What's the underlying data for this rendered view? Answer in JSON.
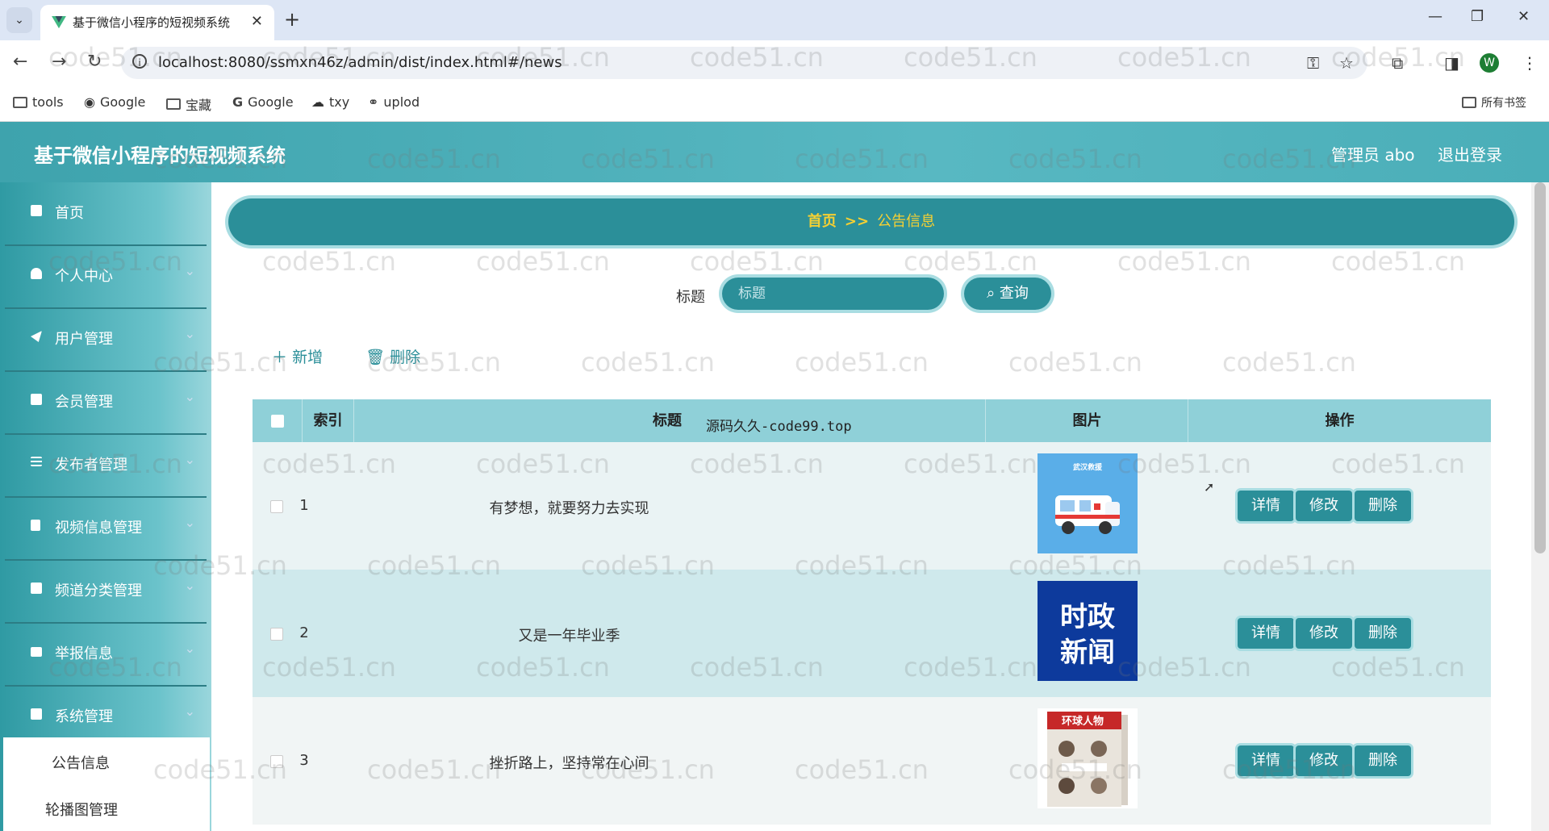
{
  "browser": {
    "tab_title": "基于微信小程序的短视频系统",
    "url": "localhost:8080/ssmxn46z/admin/dist/index.html#/news",
    "bookmarks": [
      "tools",
      "Google",
      "宝藏",
      "Google",
      "txy",
      "uplod"
    ],
    "all_bookmarks": "所有书签",
    "profile_initial": "W"
  },
  "header": {
    "brand": "基于微信小程序的短视频系统",
    "user": "管理员 abo",
    "logout": "退出登录"
  },
  "sidebar": {
    "items": [
      {
        "label": "首页",
        "icon": "home-icon"
      },
      {
        "label": "个人中心",
        "icon": "user-icon"
      },
      {
        "label": "用户管理",
        "icon": "send-icon"
      },
      {
        "label": "会员管理",
        "icon": "grid-icon"
      },
      {
        "label": "发布者管理",
        "icon": "list-icon"
      },
      {
        "label": "视频信息管理",
        "icon": "flag-icon"
      },
      {
        "label": "频道分类管理",
        "icon": "grid-icon"
      },
      {
        "label": "举报信息",
        "icon": "briefcase-icon"
      },
      {
        "label": "系统管理",
        "icon": "grid-icon"
      }
    ],
    "sub_items": [
      "公告信息",
      "轮播图管理"
    ]
  },
  "breadcrumb": {
    "home": "首页",
    "sep": ">>",
    "current": "公告信息"
  },
  "search": {
    "label": "标题",
    "placeholder": "标题",
    "button": "查询"
  },
  "actions": {
    "add": "新增",
    "delete": "删除"
  },
  "table": {
    "headers": [
      "索引",
      "标题",
      "图片",
      "操作"
    ],
    "inline_text": "源码久久-code99.top",
    "rows": [
      {
        "index": "1",
        "title": "有梦想，就要努力去实现",
        "image_text": "武汉救援"
      },
      {
        "index": "2",
        "title": "又是一年毕业季",
        "image_text": "时政新闻"
      },
      {
        "index": "3",
        "title": "挫折路上，坚持常在心间",
        "image_text": "环球人物"
      }
    ],
    "buttons": {
      "detail": "详情",
      "edit": "修改",
      "delete": "删除"
    }
  },
  "watermark": "code51.cn",
  "colors": {
    "primary": "#2b8f99",
    "accent": "#f5d033",
    "header": "#4aaeb8"
  }
}
